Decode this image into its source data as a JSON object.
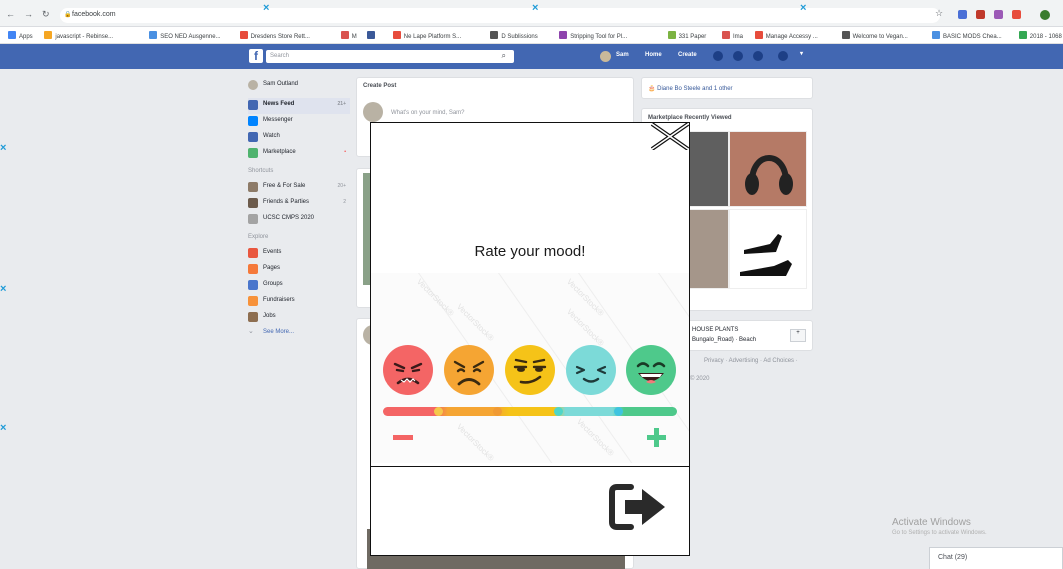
{
  "browser": {
    "url": "facebook.com",
    "bookmarks": [
      {
        "label": "Apps",
        "color": "#4285f4"
      },
      {
        "label": "javascript - Rebinse...",
        "color": "#f5a623"
      },
      {
        "label": "SEO NED Ausgenne...",
        "color": "#4a90e2"
      },
      {
        "label": "Dresdens Store Rett...",
        "color": "#e74c3c"
      },
      {
        "label": "M",
        "color": "#d9534f"
      },
      {
        "label": "",
        "color": "#3b5998"
      },
      {
        "label": "Ne Lape Platform S...",
        "color": "#e74c3c"
      },
      {
        "label": "D Sublissions",
        "color": "#555555"
      },
      {
        "label": "Stripping Tool for Pl...",
        "color": "#8e44ad"
      },
      {
        "label": "331 Paper",
        "color": "#7cb342"
      },
      {
        "label": "Ima",
        "color": "#d9534f"
      },
      {
        "label": "Manage Accessy ...",
        "color": "#e74c3c"
      },
      {
        "label": "Welcome to Vegan...",
        "color": "#555555"
      },
      {
        "label": "BASIC MODS Chea...",
        "color": "#4a90e2"
      },
      {
        "label": "2018 - 1068 planch...",
        "color": "#34a853"
      }
    ]
  },
  "facebook": {
    "search_placeholder": "Search",
    "nav": {
      "profile": "Sam",
      "home": "Home",
      "create": "Create"
    },
    "sidebar": {
      "profile": "Sam Outland",
      "items": [
        {
          "label": "News Feed",
          "count": "21+",
          "color": "#4267b2",
          "active": true
        },
        {
          "label": "Messenger",
          "count": "",
          "color": "#0084ff",
          "active": false
        },
        {
          "label": "Watch",
          "count": "",
          "color": "#4267b2",
          "active": false
        },
        {
          "label": "Marketplace",
          "count": "•",
          "color": "#4fb36e",
          "active": false
        }
      ],
      "shortcuts_heading": "Shortcuts",
      "shortcuts": [
        {
          "label": "Free & For Sale",
          "count": "20+",
          "color": "#8d7b68"
        },
        {
          "label": "Friends & Parties",
          "count": "2",
          "color": "#6c5b4c"
        },
        {
          "label": "UCSC CMPS 2020",
          "count": "",
          "color": "#a3a3a3"
        }
      ],
      "explore_heading": "Explore",
      "explore": [
        {
          "label": "Events",
          "color": "#e9573f"
        },
        {
          "label": "Pages",
          "color": "#f5793a"
        },
        {
          "label": "Groups",
          "color": "#4a76cc"
        },
        {
          "label": "Fundraisers",
          "color": "#f7923a"
        },
        {
          "label": "Jobs",
          "color": "#8d6e50"
        }
      ],
      "see_more": "See More..."
    },
    "feed": {
      "create_post": "Create Post",
      "prompt": "What's on your mind, Sam?"
    },
    "right": {
      "birthday": "Diane Bo Steele and 1 other",
      "recent_title": "Marketplace Recently Viewed",
      "suggest_line1": "HOUSE PLANTS",
      "suggest_line2": "Bungalo_Road) · Beach",
      "footer_line": "Privacy · Advertising · Ad Choices ·",
      "footer_line2": "© 2020"
    },
    "chat": {
      "label": "Chat (29)"
    }
  },
  "windows": {
    "activate_title": "Activate Windows",
    "activate_sub": "Go to Settings to activate Windows."
  },
  "modal": {
    "title": "Rate your mood!",
    "watermark": "VectorStock®",
    "moods": [
      {
        "name": "angry",
        "color": "#f46565"
      },
      {
        "name": "sad",
        "color": "#f5a533"
      },
      {
        "name": "meh",
        "color": "#f5c318"
      },
      {
        "name": "content",
        "color": "#7cdad8"
      },
      {
        "name": "happy",
        "color": "#4ec98b"
      }
    ]
  }
}
